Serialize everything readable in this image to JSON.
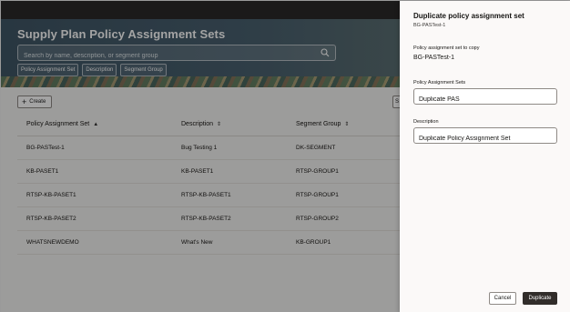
{
  "page": {
    "title": "Supply Plan Policy Assignment Sets",
    "search_placeholder": "Search by name, description, or segment group",
    "chips": [
      "Policy Assignment Set",
      "Description",
      "Segment Group"
    ],
    "create_label": "Create",
    "right_stub_label": "S"
  },
  "table": {
    "columns": [
      "Policy Assignment Set",
      "Description",
      "Segment Group"
    ],
    "rows": [
      [
        "BG-PASTest-1",
        "Bug Testing 1",
        "DK-SEGMENT"
      ],
      [
        "KB-PASET1",
        "KB-PASET1",
        "RTSP-GROUP1"
      ],
      [
        "RTSP-KB-PASET1",
        "RTSP-KB-PASET1",
        "RTSP-GROUP1"
      ],
      [
        "RTSP-KB-PASET2",
        "RTSP-KB-PASET2",
        "RTSP-GROUP2"
      ],
      [
        "WHATSNEWDEMO",
        "What's New",
        "KB-GROUP1"
      ]
    ]
  },
  "drawer": {
    "title": "Duplicate policy assignment set",
    "subtitle": "BG-PASTest-1",
    "copy_label": "Policy assignment set to copy",
    "copy_value": "BG-PASTest-1",
    "sets_label": "Policy Assignment Sets",
    "sets_value": "Duplicate PAS",
    "desc_label": "Description",
    "desc_value": "Duplicate Policy Assignment Set",
    "cancel_label": "Cancel",
    "duplicate_label": "Duplicate"
  },
  "icons": {
    "search": "search-icon",
    "plus": "plus-icon",
    "sort": "sort-icon"
  },
  "colors": {
    "primary_button": "#312d2a",
    "banner": "#4a6170"
  }
}
